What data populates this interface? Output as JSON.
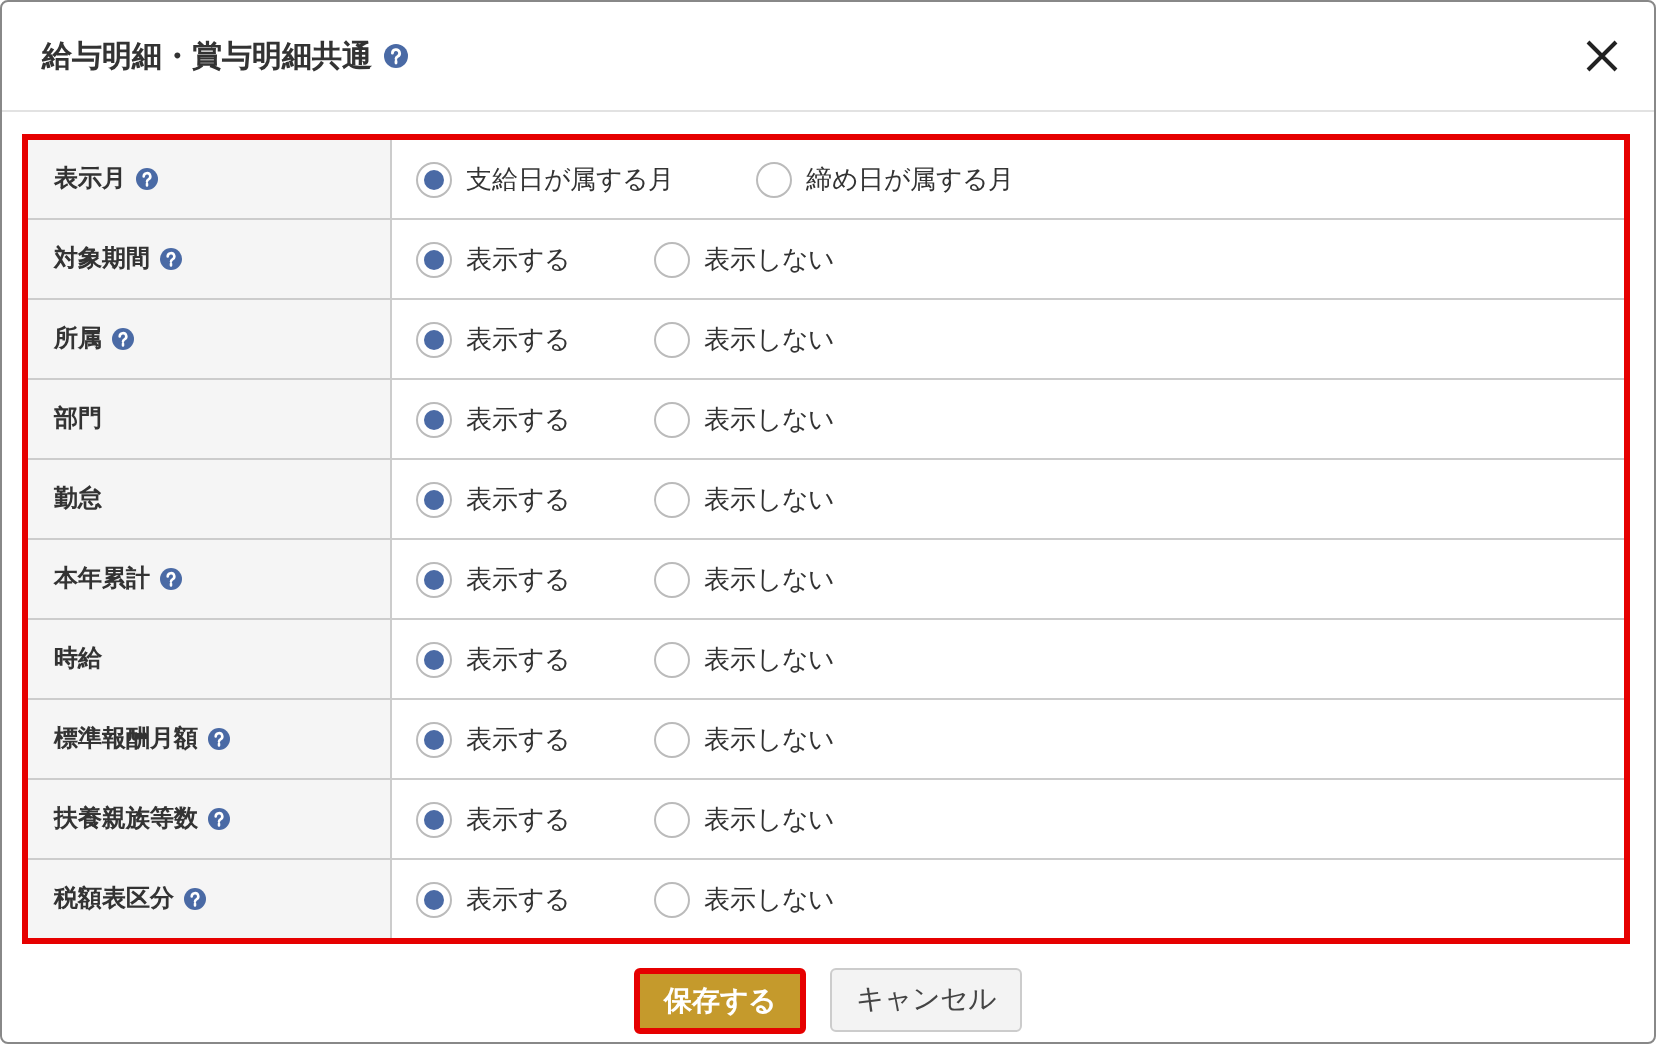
{
  "dialog": {
    "title": "給与明細・賞与明細共通",
    "help": true
  },
  "rows": [
    {
      "label": "表示月",
      "help": true,
      "options": [
        {
          "label": "支給日が属する月",
          "selected": true
        },
        {
          "label": "締め日が属する月",
          "selected": false
        }
      ]
    },
    {
      "label": "対象期間",
      "help": true,
      "options": [
        {
          "label": "表示する",
          "selected": true
        },
        {
          "label": "表示しない",
          "selected": false
        }
      ]
    },
    {
      "label": "所属",
      "help": true,
      "options": [
        {
          "label": "表示する",
          "selected": true
        },
        {
          "label": "表示しない",
          "selected": false
        }
      ]
    },
    {
      "label": "部門",
      "help": false,
      "options": [
        {
          "label": "表示する",
          "selected": true
        },
        {
          "label": "表示しない",
          "selected": false
        }
      ]
    },
    {
      "label": "勤怠",
      "help": false,
      "options": [
        {
          "label": "表示する",
          "selected": true
        },
        {
          "label": "表示しない",
          "selected": false
        }
      ]
    },
    {
      "label": "本年累計",
      "help": true,
      "options": [
        {
          "label": "表示する",
          "selected": true
        },
        {
          "label": "表示しない",
          "selected": false
        }
      ]
    },
    {
      "label": "時給",
      "help": false,
      "options": [
        {
          "label": "表示する",
          "selected": true
        },
        {
          "label": "表示しない",
          "selected": false
        }
      ]
    },
    {
      "label": "標準報酬月額",
      "help": true,
      "options": [
        {
          "label": "表示する",
          "selected": true
        },
        {
          "label": "表示しない",
          "selected": false
        }
      ]
    },
    {
      "label": "扶養親族等数",
      "help": true,
      "options": [
        {
          "label": "表示する",
          "selected": true
        },
        {
          "label": "表示しない",
          "selected": false
        }
      ]
    },
    {
      "label": "税額表区分",
      "help": true,
      "options": [
        {
          "label": "表示する",
          "selected": true
        },
        {
          "label": "表示しない",
          "selected": false
        }
      ]
    }
  ],
  "buttons": [
    {
      "label": "保存する",
      "kind": "primary"
    },
    {
      "label": "キャンセル",
      "kind": "secondary"
    }
  ]
}
